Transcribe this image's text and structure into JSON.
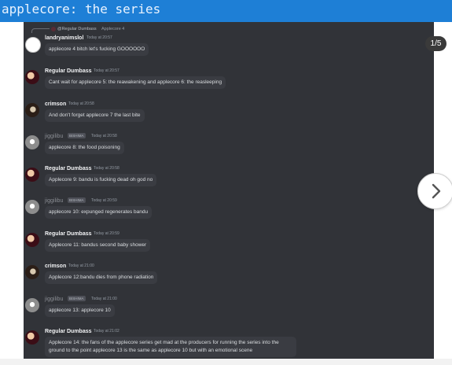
{
  "page": {
    "title": "applecore: the series"
  },
  "carousel": {
    "counter": "1/5",
    "next_icon": "chevron-right-icon"
  },
  "reply_preview": {
    "name": "@Regular Dumbass",
    "text": "Applecore 4"
  },
  "messages": [
    {
      "author": "landryanimslol",
      "time": "Today at 20:57",
      "text": "applecore 4 bitch let's fucking GOOOOOO"
    },
    {
      "author": "Regular Dumbass",
      "time": "Today at 20:57",
      "text": "Cant wait for applecore 5: the reawakening and applecore 6: the reasleeping"
    },
    {
      "author": "crimson",
      "time": "Today at 20:58",
      "text": "And don't forget applecore 7 the last bite"
    },
    {
      "author": "jiggilibu",
      "tag": "BISHIMA",
      "time": "Today at 20:58",
      "text": "applecore 8: the food poisoning"
    },
    {
      "author": "Regular Dumbass",
      "time": "Today at 20:58",
      "text": "Applecore 9: bandu is fucking dead oh god no"
    },
    {
      "author": "jiggilibu",
      "tag": "BISHIMA",
      "time": "Today at 20:59",
      "text": "applecore 10: expunged regenerates bandu"
    },
    {
      "author": "Regular Dumbass",
      "time": "Today at 20:59",
      "text": "Applecore 11: bandus second baby shower"
    },
    {
      "author": "crimson",
      "time": "Today at 21:00",
      "text": "Applecore 12:bandu dies from phone radiation"
    },
    {
      "author": "jiggilibu",
      "tag": "BISHIMA",
      "time": "Today at 21:00",
      "text": "applecore 13: applecore 10"
    },
    {
      "author": "Regular Dumbass",
      "time": "Today at 21:02",
      "text": "Applecore 14: the fans of the applecore series get mad at the producers for running the series into the ground to the point applecore 13 is the same as applecore 10 but with an emotional scene"
    }
  ],
  "colors": {
    "top_bar": "#1e7fd6",
    "chat_background": "#313338",
    "bubble": "#3a3c42"
  }
}
